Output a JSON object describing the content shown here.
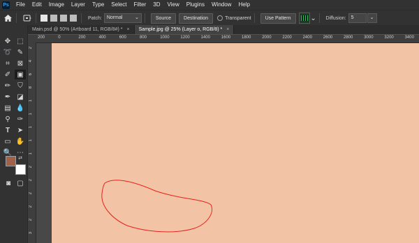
{
  "menubar": {
    "logo": "Ps",
    "items": [
      "File",
      "Edit",
      "Image",
      "Layer",
      "Type",
      "Select",
      "Filter",
      "3D",
      "View",
      "Plugins",
      "Window",
      "Help"
    ]
  },
  "options": {
    "patch_label": "Patch:",
    "patch_value": "Normal",
    "source_label": "Source",
    "destination_label": "Destination",
    "transparent_label": "Transparent",
    "use_pattern_label": "Use Pattern",
    "diffusion_label": "Diffusion:",
    "diffusion_value": "5"
  },
  "tabs": [
    {
      "label": "Main.psd @ 50% (Artboard 11, RGB/8#) *",
      "close": "×"
    },
    {
      "label": "Sample.jpg @ 25% (Layer o, RGB/8) *",
      "close": "×"
    }
  ],
  "ruler": {
    "h_labels": [
      "200",
      "0",
      "200",
      "400",
      "600",
      "800",
      "1000",
      "1200",
      "1400",
      "1600",
      "1800",
      "2000",
      "2200",
      "2400",
      "2600",
      "2800",
      "3000",
      "3200",
      "3400"
    ],
    "v_labels": [
      "2",
      "4",
      "6",
      "8",
      "1",
      "1",
      "1",
      "1",
      "1",
      "2",
      "2",
      "2",
      "2",
      "2",
      "3"
    ]
  },
  "colors": {
    "foreground": "#a0614a",
    "background": "#ffffff",
    "selection_outline": "#e8201a"
  }
}
